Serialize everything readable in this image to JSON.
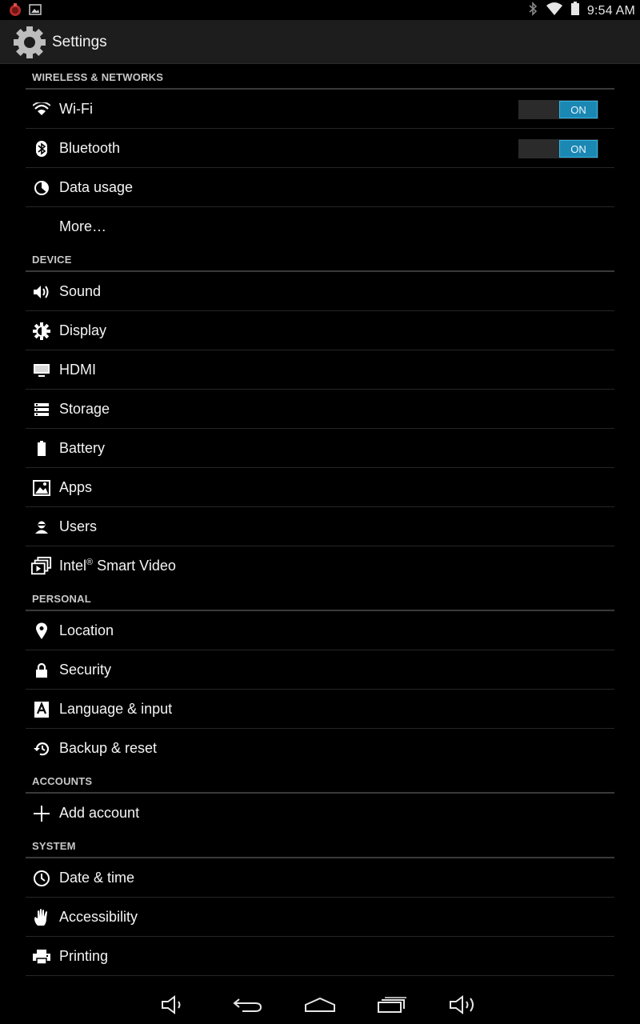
{
  "status_bar": {
    "time": "9:54 AM",
    "icons": [
      "app-notification-icon",
      "image-notification-icon",
      "bluetooth-icon",
      "wifi-icon",
      "battery-icon"
    ]
  },
  "action_bar": {
    "title": "Settings",
    "icon": "settings-gear-icon"
  },
  "sections": {
    "wireless": {
      "header": "WIRELESS & NETWORKS",
      "wifi": {
        "label": "Wi-Fi",
        "icon": "wifi-icon",
        "toggle": "ON"
      },
      "bluetooth": {
        "label": "Bluetooth",
        "icon": "bluetooth-icon",
        "toggle": "ON"
      },
      "data_usage": {
        "label": "Data usage",
        "icon": "data-usage-icon"
      },
      "more": {
        "label": "More…"
      }
    },
    "device": {
      "header": "DEVICE",
      "sound": {
        "label": "Sound",
        "icon": "speaker-icon"
      },
      "display": {
        "label": "Display",
        "icon": "brightness-icon"
      },
      "hdmi": {
        "label": "HDMI",
        "icon": "monitor-icon"
      },
      "storage": {
        "label": "Storage",
        "icon": "storage-icon"
      },
      "battery": {
        "label": "Battery",
        "icon": "battery-icon"
      },
      "apps": {
        "label": "Apps",
        "icon": "apps-icon"
      },
      "users": {
        "label": "Users",
        "icon": "user-icon"
      },
      "intel": {
        "label_prefix": "Intel",
        "label_sup": "®",
        "label_suffix": " Smart Video",
        "icon": "video-icon"
      }
    },
    "personal": {
      "header": "PERSONAL",
      "location": {
        "label": "Location",
        "icon": "location-pin-icon"
      },
      "security": {
        "label": "Security",
        "icon": "lock-icon"
      },
      "language": {
        "label": "Language & input",
        "icon": "keyboard-a-icon"
      },
      "backup": {
        "label": "Backup & reset",
        "icon": "backup-restore-icon"
      }
    },
    "accounts": {
      "header": "ACCOUNTS",
      "add_account": {
        "label": "Add account",
        "icon": "plus-icon"
      }
    },
    "system": {
      "header": "SYSTEM",
      "date_time": {
        "label": "Date & time",
        "icon": "clock-icon"
      },
      "accessibility": {
        "label": "Accessibility",
        "icon": "hand-icon"
      },
      "printing": {
        "label": "Printing",
        "icon": "printer-icon"
      }
    }
  },
  "nav_bar": {
    "buttons": [
      "volume-down-icon",
      "back-icon",
      "home-icon",
      "recents-icon",
      "volume-up-icon"
    ]
  },
  "colors": {
    "background": "#000000",
    "action_bar": "#1d1d1d",
    "accent": "#33b5e5",
    "toggle_on": "#1b87b3"
  }
}
